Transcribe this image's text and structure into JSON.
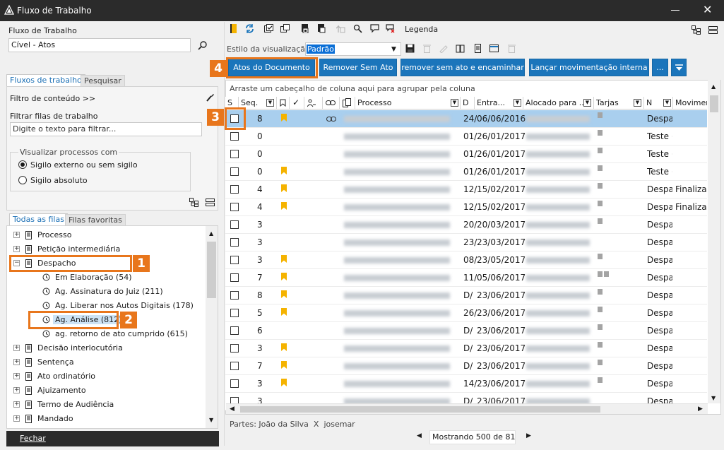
{
  "window": {
    "title": "Fluxo de Trabalho"
  },
  "left": {
    "label_fluxo": "Fluxo de Trabalho",
    "fluxo_value": "Cível - Atos",
    "tabs": {
      "fluxos": "Fluxos de trabalho",
      "pesquisar": "Pesquisar"
    },
    "filtro_conteudo": "Filtro de conteúdo >>",
    "filtrar_filas_label": "Filtrar filas de trabalho",
    "filtrar_placeholder": "Digite o texto para filtrar...",
    "visualizar_title": "Visualizar processos com",
    "radio_externo": "Sigilo externo ou sem sigilo",
    "radio_absoluto": "Sigilo absoluto",
    "lower_tabs": {
      "todas": "Todas as filas",
      "favoritas": "Filas favoritas"
    },
    "tree": [
      {
        "label": "Processo",
        "level": 0,
        "expander": "+"
      },
      {
        "label": "Petição intermediária",
        "level": 0,
        "expander": "+"
      },
      {
        "label": "Despacho",
        "level": 0,
        "expander": "−"
      },
      {
        "label": "Em Elaboração (54)",
        "level": 1
      },
      {
        "label": "Ag. Assinatura do Juiz (211)",
        "level": 1
      },
      {
        "label": "Ag. Liberar nos Autos Digitais (178)",
        "level": 1
      },
      {
        "label": "Ag. Análise (812)",
        "level": 1,
        "selected": true
      },
      {
        "label": "ag. retorno de ato cumprido (615)",
        "level": 1
      },
      {
        "label": "Decisão interlocutória",
        "level": 0,
        "expander": "+"
      },
      {
        "label": "Sentença",
        "level": 0,
        "expander": "+"
      },
      {
        "label": "Ato ordinatório",
        "level": 0,
        "expander": "+"
      },
      {
        "label": "Ajuizamento",
        "level": 0,
        "expander": "+"
      },
      {
        "label": "Termo de Audiência",
        "level": 0,
        "expander": "+"
      },
      {
        "label": "Mandado",
        "level": 0,
        "expander": "+"
      }
    ],
    "fechar": "Fechar"
  },
  "toolbar": {
    "legenda": "Legenda",
    "estilo_label": "Estilo da visualização",
    "estilo_value": "Padrão",
    "buttons": {
      "atos": "Atos do Documento",
      "remover": "Remover Sem Ato",
      "remover_enc": "remover sem ato e encaminhar",
      "lancar": "Lançar movimentação interna",
      "more": "..."
    }
  },
  "grid": {
    "group_hint": "Arraste um cabeçalho de coluna aqui para agrupar pela coluna",
    "headers": {
      "s": "S",
      "seq": "Seq.",
      "processo": "Processo",
      "d": "D",
      "entrada": "Entra...",
      "alocado": "Alocado para ...",
      "tarjas": "Tarjas",
      "n": "N",
      "movim": "Movimen"
    },
    "rows": [
      {
        "seq": "8",
        "flag": true,
        "link": true,
        "d": "24/",
        "date": "06/06/2016",
        "tarjas": 1,
        "n": "Despa",
        "m": "",
        "sel": true
      },
      {
        "seq": "0",
        "flag": false,
        "d": "01/",
        "date": "26/01/2017",
        "tarjas": 1,
        "n": "Teste (",
        "m": ""
      },
      {
        "seq": "0",
        "flag": false,
        "d": "01/",
        "date": "26/01/2017",
        "tarjas": 1,
        "n": "Teste (",
        "m": ""
      },
      {
        "seq": "0",
        "flag": true,
        "d": "01/",
        "date": "26/01/2017",
        "tarjas": 1,
        "n": "Teste (",
        "m": ""
      },
      {
        "seq": "4",
        "flag": true,
        "d": "12/",
        "date": "15/02/2017",
        "tarjas": 1,
        "n": "Despa",
        "m": "Finalizac"
      },
      {
        "seq": "4",
        "flag": true,
        "d": "12/",
        "date": "15/02/2017",
        "tarjas": 1,
        "n": "Despa",
        "m": "Finalizac"
      },
      {
        "seq": "3",
        "flag": false,
        "d": "20/",
        "date": "20/03/2017",
        "tarjas": 1,
        "n": "Despa",
        "m": ""
      },
      {
        "seq": "3",
        "flag": false,
        "d": "23/",
        "date": "23/03/2017",
        "tarjas": 0,
        "n": "Despa",
        "m": ""
      },
      {
        "seq": "3",
        "flag": true,
        "d": "08/",
        "date": "23/05/2017",
        "tarjas": 1,
        "n": "Despa",
        "m": ""
      },
      {
        "seq": "7",
        "flag": true,
        "d": "11/",
        "date": "05/06/2017",
        "tarjas": 2,
        "n": "Despa",
        "m": ""
      },
      {
        "seq": "8",
        "flag": true,
        "d": "D/",
        "date": "23/06/2017",
        "tarjas": 1,
        "n": "Despa",
        "m": ""
      },
      {
        "seq": "5",
        "flag": true,
        "d": "26/",
        "date": "23/06/2017",
        "tarjas": 1,
        "n": "Despa",
        "m": ""
      },
      {
        "seq": "6",
        "flag": false,
        "d": "D/",
        "date": "23/06/2017",
        "tarjas": 1,
        "n": "Despa",
        "m": ""
      },
      {
        "seq": "3",
        "flag": true,
        "d": "D/",
        "date": "23/06/2017",
        "tarjas": 1,
        "n": "Despa",
        "m": ""
      },
      {
        "seq": "7",
        "flag": true,
        "d": "D/",
        "date": "23/06/2017",
        "tarjas": 1,
        "n": "Despa",
        "m": ""
      },
      {
        "seq": "3",
        "flag": true,
        "d": "14/",
        "date": "23/06/2017",
        "tarjas": 1,
        "n": "Despa",
        "m": ""
      },
      {
        "seq": "3",
        "flag": false,
        "d": "D/",
        "date": "23/06/2017",
        "tarjas": 0,
        "n": "Despa",
        "m": ""
      }
    ]
  },
  "footer": {
    "partes": "Partes: João da Silva  X  josemar",
    "mostrando": "Mostrando 500 de 812"
  },
  "callouts": [
    "1",
    "2",
    "3",
    "4"
  ],
  "colors": {
    "accent": "#e8761c",
    "primary": "#1b75bb",
    "selection": "#a9cfee",
    "flag": "#f5b300"
  }
}
